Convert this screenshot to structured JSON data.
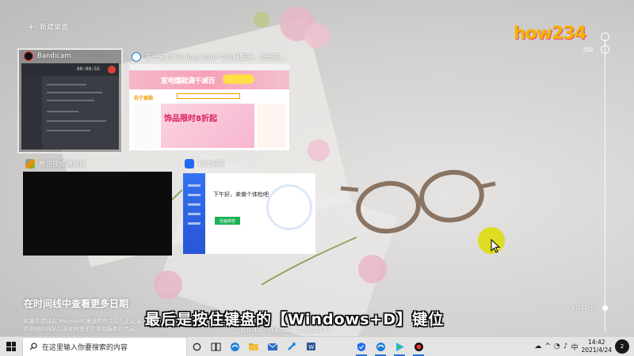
{
  "desktop": {
    "new_desktop_label": "新建桌面"
  },
  "windows": [
    {
      "title": "Bandicam",
      "timer": "00:00:55"
    },
    {
      "title": "苏宁易购(Suning.com)-专注好服务，送货更...",
      "banner_text": "家电爆款满千减百",
      "logo_text": "苏宁易购",
      "hero_text": "饰品限时8折起"
    },
    {
      "title": "腾讯视频播放器"
    },
    {
      "title": "电脑管家",
      "greeting": "下午好，来做个体检吧",
      "scan_button": "全面体检"
    }
  ],
  "timeline": {
    "now_label": "当前",
    "date_label": "4月21日"
  },
  "watermark": "how234",
  "more_dates": {
    "title": "在时间线中查看更多日期",
    "desc_line1": "如果你选择向 Microsoft 发送你的活动历史记录",
    "desc_line2": "你浏览的网站以及如何使用应用和服务的信息。",
    "desc_right": "个性化体验的详细信息，请参阅我们的"
  },
  "subtitle": "最后是按住键盘的【Windows+D】键位",
  "taskbar": {
    "search_placeholder": "在这里输入你要搜索的内容",
    "time": "14:42",
    "date": "2021/4/24",
    "notification_count": "2"
  },
  "colors": {
    "accent": "#2b72d8",
    "cursor_highlight": "#dcdc00",
    "suning_orange": "#f39800"
  }
}
